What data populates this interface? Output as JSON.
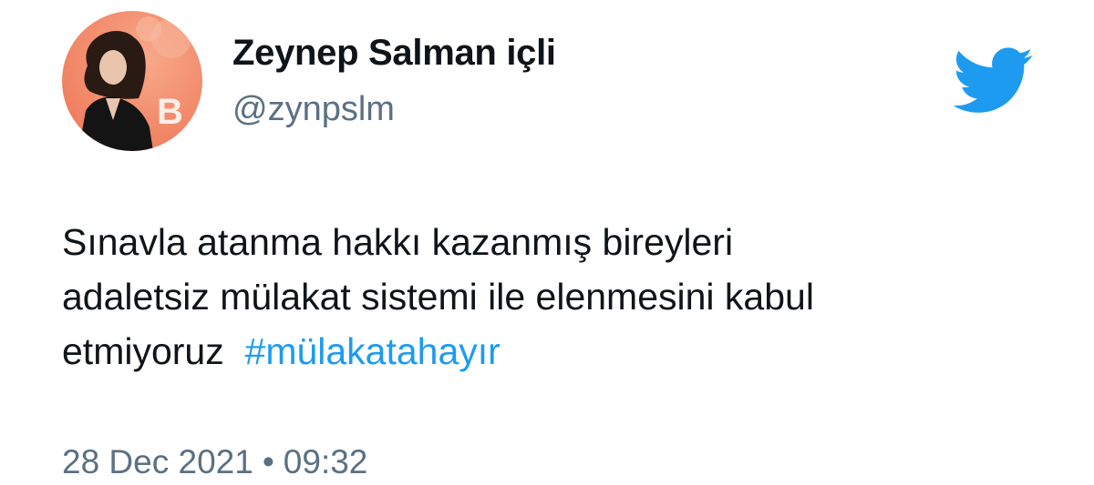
{
  "user": {
    "display_name": "Zeynep Salman içli",
    "handle": "@zynpslm",
    "avatar_icon": "profile-photo"
  },
  "logo": {
    "icon": "twitter-bird-icon",
    "color": "#1d9bf0"
  },
  "tweet": {
    "line1": "Sınavla atanma hakkı kazanmış bireyleri",
    "line2": "adaletsiz mülakat sistemi ile elenmesini kabul",
    "line3": "etmiyoruz",
    "hashtag": "#mülakatahayır"
  },
  "meta": {
    "date": "28 Dec 2021",
    "separator": "•",
    "time": "09:32"
  },
  "colors": {
    "text": "#0f1419",
    "secondary": "#5b7083",
    "link": "#1d9bf0",
    "avatar_bg": "#f28b68"
  }
}
